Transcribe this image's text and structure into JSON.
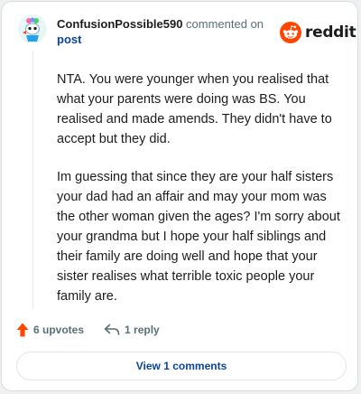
{
  "comment": {
    "username": "ConfusionPossible590",
    "action_text": "commented on",
    "target": "post",
    "paragraphs": [
      "NTA. You were younger when you realised that what your parents were doing was BS. You realised and made amends. They didn't have to accept but they did.",
      "Im guessing that since they are your half sisters your dad had an affair and may your mom was the other woman given the ages? I'm sorry about your grandma but I hope your half siblings and their family are doing well and hope that your sister realises what terrible toxic people your family are."
    ]
  },
  "brand": {
    "name": "reddit",
    "color": "#ff4500"
  },
  "actions": {
    "upvotes_label": "6 upvotes",
    "reply_label": "1 reply"
  },
  "view_comments_label": "View 1 comments",
  "colors": {
    "upvote": "#ff4500",
    "link": "#0a449b",
    "muted": "#576f76"
  }
}
